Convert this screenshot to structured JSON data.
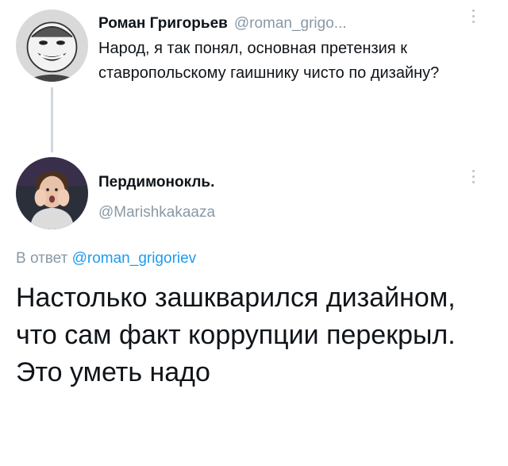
{
  "tweet_parent": {
    "author_name": "Роман Григорьев",
    "author_handle": "@roman_grigo...",
    "text": "Народ, я так понял, основная претензия к ставропольскому гаишнику чисто по дизайну?",
    "avatar_icon": "trollface-meme-avatar"
  },
  "tweet_reply": {
    "author_name": "Пердимонокль.",
    "author_handle": "@Marishkakaaza",
    "reply_prefix": "В ответ",
    "reply_to_handle": "@roman_grigoriev",
    "text": "Настолько зашкварился дизайном, что сам факт коррупции перекрыл. Это уметь надо",
    "avatar_icon": "woman-hands-on-cheeks-avatar"
  },
  "colors": {
    "text": "#0f1419",
    "secondary": "#8899a6",
    "link": "#1d9bf0",
    "thread_line": "#cfd9de"
  }
}
